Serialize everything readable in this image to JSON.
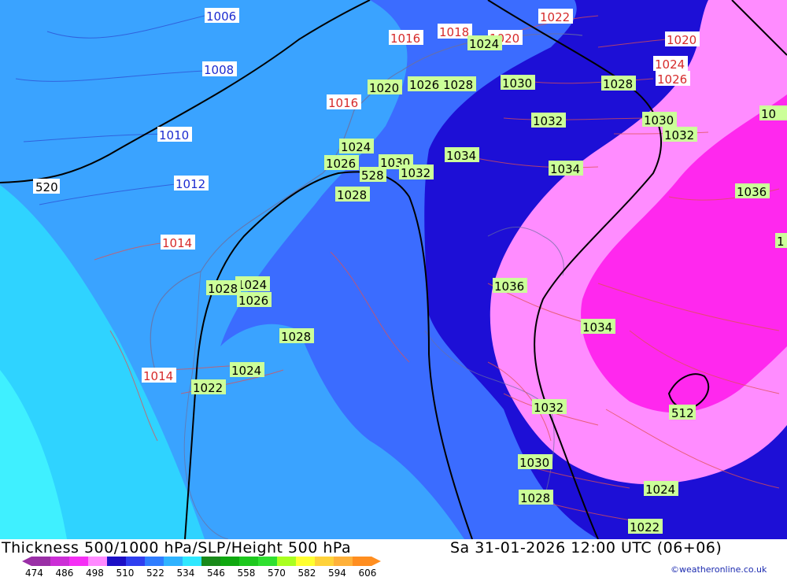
{
  "header": {
    "title": "Thickness 500/1000 hPa/SLP/Height 500 hPa",
    "valid_time": "Sa 31-01-2026 12:00 UTC (06+06)"
  },
  "credit": "©weatheronline.co.uk",
  "legend": {
    "values": [
      "474",
      "486",
      "498",
      "510",
      "522",
      "534",
      "546",
      "558",
      "570",
      "582",
      "594",
      "606"
    ],
    "colors": [
      "#9a2fa6",
      "#cc2fd6",
      "#f52ff5",
      "#ff8aff",
      "#1c0fc6",
      "#2f3ff0",
      "#2f7dff",
      "#2fb3ff",
      "#2fe8ff",
      "#1a8a1a",
      "#10a810",
      "#1ec81e",
      "#30e030",
      "#aaff20",
      "#ffff30",
      "#ffd23a",
      "#ffb13a",
      "#ff8e20"
    ]
  },
  "colors": {
    "background_outer": "#3aa3ff",
    "band_522": "#2ecfff",
    "band_528": "#3aa3ff",
    "band_516": "#3b6cff",
    "band_504": "#1d0fd6",
    "band_498": "#ff8cff",
    "band_492": "#ff28ee",
    "isobar_color": "#e05050",
    "height_contour_color": "#000000"
  },
  "isobar_labels": [
    {
      "text": "1006",
      "color": "blue"
    },
    {
      "text": "1008",
      "color": "blue"
    },
    {
      "text": "1010",
      "color": "blue"
    },
    {
      "text": "1012",
      "color": "blue"
    },
    {
      "text": "1014",
      "color": "red"
    },
    {
      "text": "1014",
      "color": "red"
    },
    {
      "text": "1016",
      "color": "red"
    },
    {
      "text": "1018",
      "color": "red"
    },
    {
      "text": "1020",
      "color": "red"
    },
    {
      "text": "1020",
      "color": "red"
    },
    {
      "text": "1022",
      "color": "red"
    },
    {
      "text": "1024",
      "color": "red"
    },
    {
      "text": "1026",
      "color": "red"
    },
    {
      "text": "1016",
      "color": "red"
    },
    {
      "text": "1024",
      "color": "green"
    },
    {
      "text": "1020",
      "color": "green"
    },
    {
      "text": "1026",
      "color": "green"
    },
    {
      "text": "1028",
      "color": "green"
    },
    {
      "text": "1030",
      "color": "green"
    },
    {
      "text": "1028",
      "color": "green"
    },
    {
      "text": "1032",
      "color": "green"
    },
    {
      "text": "1030",
      "color": "green"
    },
    {
      "text": "1032",
      "color": "green"
    },
    {
      "text": "1024",
      "color": "green"
    },
    {
      "text": "1026",
      "color": "green"
    },
    {
      "text": "1030",
      "color": "green"
    },
    {
      "text": "1032",
      "color": "green"
    },
    {
      "text": "1034",
      "color": "green"
    },
    {
      "text": "1034",
      "color": "green"
    },
    {
      "text": "1036",
      "color": "green"
    },
    {
      "text": "1028",
      "color": "green"
    },
    {
      "text": "1024",
      "color": "green"
    },
    {
      "text": "1026",
      "color": "green"
    },
    {
      "text": "1028",
      "color": "green"
    },
    {
      "text": "1024",
      "color": "green"
    },
    {
      "text": "1022",
      "color": "green"
    },
    {
      "text": "1036",
      "color": "green"
    },
    {
      "text": "1034",
      "color": "green"
    },
    {
      "text": "1032",
      "color": "green"
    },
    {
      "text": "1030",
      "color": "green"
    },
    {
      "text": "1028",
      "color": "green"
    },
    {
      "text": "1024",
      "color": "green"
    },
    {
      "text": "1022",
      "color": "green"
    },
    {
      "text": "1036",
      "color": "green"
    },
    {
      "text": "1024",
      "color": "green"
    },
    {
      "text": "1026",
      "color": "green"
    },
    {
      "text": "1028",
      "color": "green"
    },
    {
      "text": "1030",
      "color": "green"
    },
    {
      "text": "1032",
      "color": "green"
    },
    {
      "text": "1020",
      "color": "red"
    },
    {
      "text": "1028",
      "color": "green"
    },
    {
      "text": "1026",
      "color": "green"
    },
    {
      "text": "1024",
      "color": "green"
    },
    {
      "text": "1022",
      "color": "green"
    },
    {
      "text": "10",
      "color": "green"
    },
    {
      "text": "1",
      "color": "green"
    }
  ],
  "height_labels": [
    "520",
    "528",
    "512"
  ]
}
